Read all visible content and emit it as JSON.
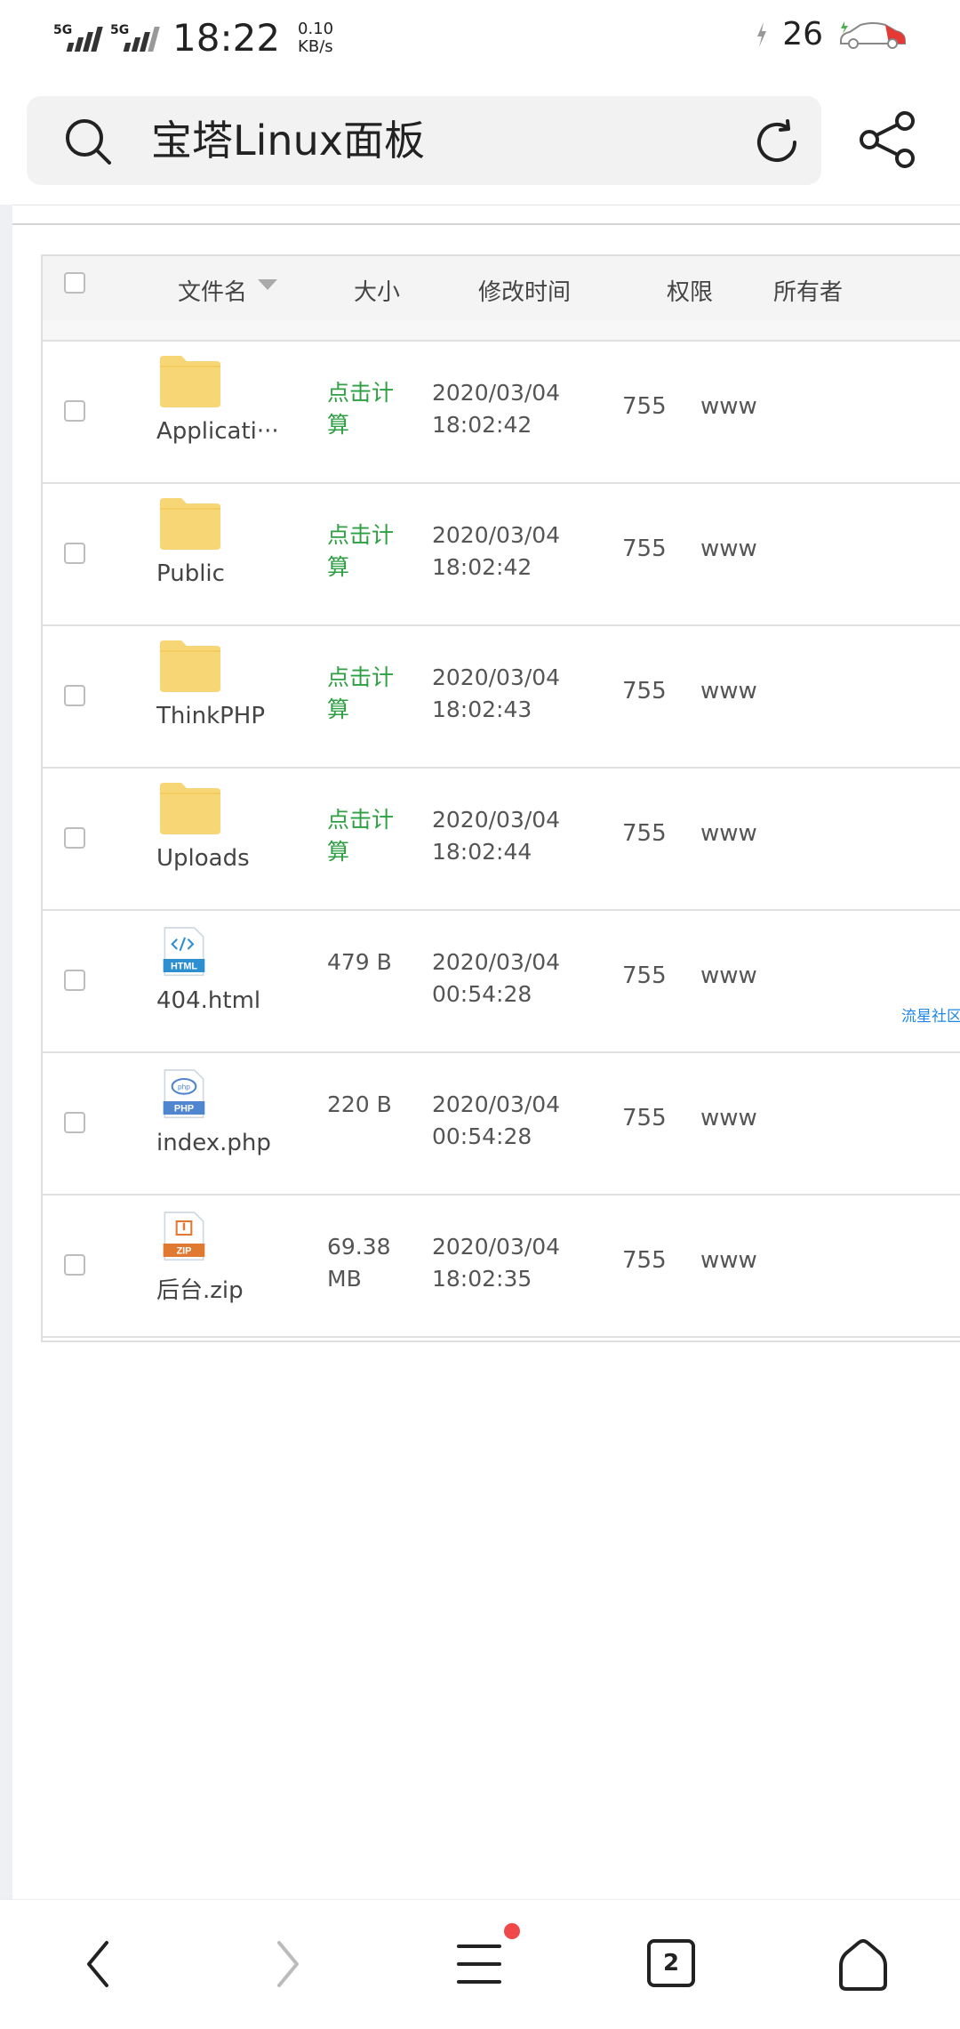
{
  "status_bar": {
    "signal1_label": "5G",
    "signal2_label": "5G",
    "time": "18:22",
    "speed_value": "0.10",
    "speed_unit": "KB/s",
    "battery": "26"
  },
  "address_bar": {
    "title": "宝塔Linux面板"
  },
  "table": {
    "columns": {
      "name": "文件名",
      "size": "大小",
      "modified": "修改时间",
      "permission": "权限",
      "owner": "所有者"
    },
    "rows": [
      {
        "type": "folder",
        "name": "Applicati···",
        "size1": "点击计",
        "size2": "算",
        "date": "2020/03/04",
        "time": "18:02:42",
        "perm": "755",
        "owner": "www"
      },
      {
        "type": "folder",
        "name": "Public",
        "size1": "点击计",
        "size2": "算",
        "date": "2020/03/04",
        "time": "18:02:42",
        "perm": "755",
        "owner": "www"
      },
      {
        "type": "folder",
        "name": "ThinkPHP",
        "size1": "点击计",
        "size2": "算",
        "date": "2020/03/04",
        "time": "18:02:43",
        "perm": "755",
        "owner": "www"
      },
      {
        "type": "folder",
        "name": "Uploads",
        "size1": "点击计",
        "size2": "算",
        "date": "2020/03/04",
        "time": "18:02:44",
        "perm": "755",
        "owner": "www"
      },
      {
        "type": "html",
        "icon_label": "HTML",
        "name": "404.html",
        "size1": "479 B",
        "size2": "",
        "date": "2020/03/04",
        "time": "00:54:28",
        "perm": "755",
        "owner": "www"
      },
      {
        "type": "php",
        "icon_label": "PHP",
        "name": "index.php",
        "size1": "220 B",
        "size2": "",
        "date": "2020/03/04",
        "time": "00:54:28",
        "perm": "755",
        "owner": "www"
      },
      {
        "type": "zip",
        "icon_label": "ZIP",
        "name": "后台.zip",
        "size1": "69.38",
        "size2": "MB",
        "date": "2020/03/04",
        "time": "18:02:35",
        "perm": "755",
        "owner": "www"
      }
    ]
  },
  "watermark": "流星社区",
  "bottom_nav": {
    "tab_count": "2"
  },
  "colors": {
    "folder": "#f7d775",
    "green_link": "#2ea043",
    "html_badge": "#2d8fcf",
    "php_badge": "#4f86cf",
    "zip_badge": "#e07a32",
    "notification_dot": "#f04848"
  }
}
